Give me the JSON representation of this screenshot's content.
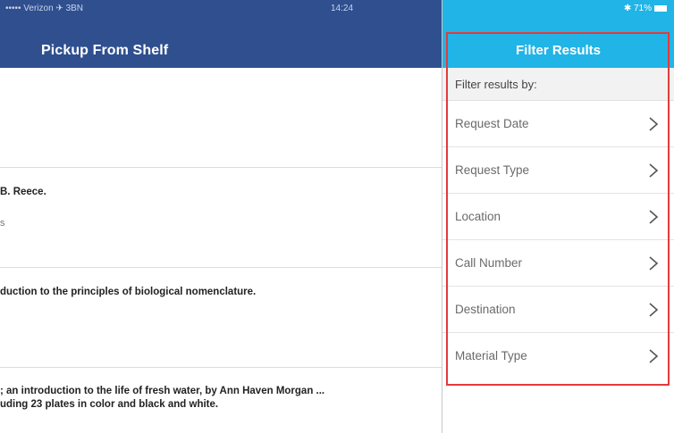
{
  "left": {
    "status": {
      "carrier": "••••• Verizon ✈ 3BN",
      "time": "14:24"
    },
    "nav_title": "Pickup From Shelf",
    "rows": [
      {
        "line1": "",
        "line2": ""
      },
      {
        "line1": "B. Reece.",
        "line2": "s"
      },
      {
        "line1": "duction to the principles of biological nomenclature.",
        "line2": ""
      },
      {
        "line1": "; an introduction to the life of fresh water, by Ann Haven Morgan ...",
        "line2": "uding 23 plates in color and black and white."
      }
    ]
  },
  "right": {
    "status": {
      "battery": "✱ 71%"
    },
    "title": "Filter Results",
    "section_label": "Filter results by:",
    "filters": [
      {
        "label": "Request Date"
      },
      {
        "label": "Request Type"
      },
      {
        "label": "Location"
      },
      {
        "label": "Call Number"
      },
      {
        "label": "Destination"
      },
      {
        "label": "Material Type"
      }
    ]
  },
  "colors": {
    "nav_left": "#2f4f8f",
    "nav_right": "#21b4e6",
    "highlight": "#e33b3b"
  },
  "icons": {
    "chevron": "chevron-right-icon"
  }
}
